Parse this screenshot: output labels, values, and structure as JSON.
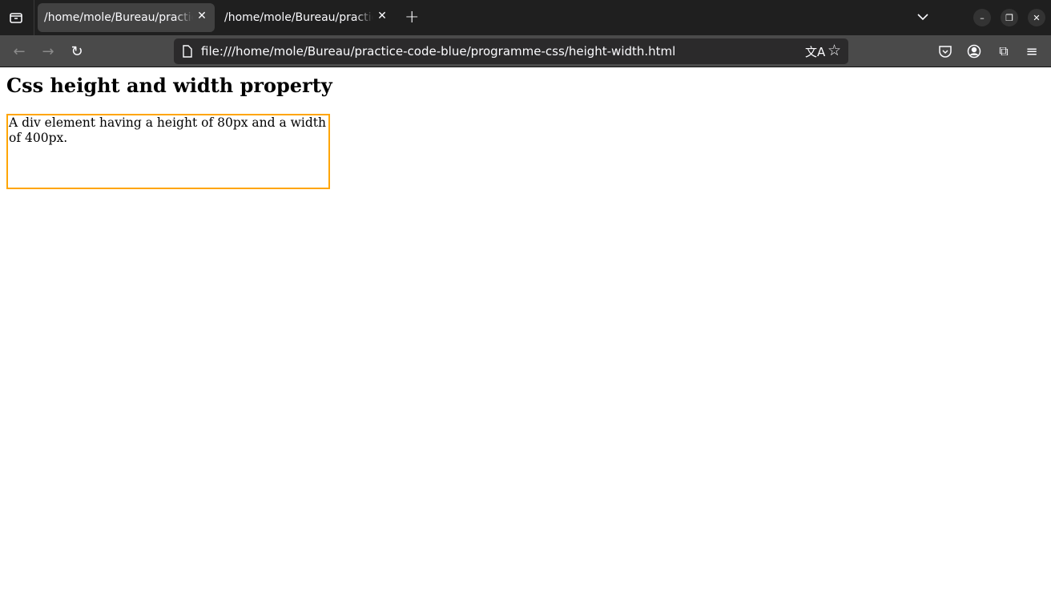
{
  "browser": {
    "tabs": [
      {
        "title": "/home/mole/Bureau/practice-code-blue/programme-css/height-width.html",
        "active": true
      },
      {
        "title": "/home/mole/Bureau/practice-code-blue/programme-css/height-width.html",
        "active": false
      }
    ],
    "url": "file:///home/mole/Bureau/practice-code-blue/programme-css/height-width.html"
  },
  "page": {
    "heading": "Css height and width property",
    "box_text": "A div element having a height of 80px and a width of 400px.",
    "box_border_color": "#ffa500"
  }
}
